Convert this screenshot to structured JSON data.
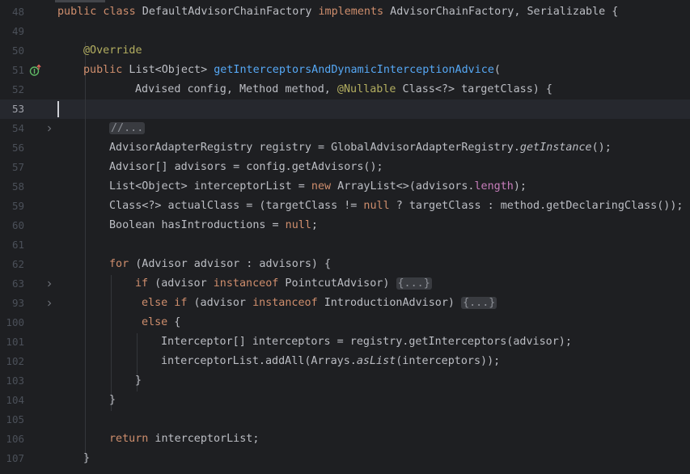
{
  "gutter": {
    "line_numbers": [
      "48",
      "49",
      "50",
      "51",
      "52",
      "53",
      "54",
      "56",
      "57",
      "58",
      "59",
      "60",
      "61",
      "62",
      "63",
      "93",
      "100",
      "101",
      "102",
      "103",
      "104",
      "105",
      "106",
      "107"
    ],
    "current_line": "53",
    "override_icon": "implements-method-icon",
    "fold_icon": "chevron-right-icon"
  },
  "code": {
    "l48_kw1": "public class",
    "l48_name": " DefaultAdvisorChainFactory ",
    "l48_kw2": "implements",
    "l48_rest": " AdvisorChainFactory, Serializable {",
    "l50_ann": "@Override",
    "l51_kw": "public",
    "l51_type": " List<Object> ",
    "l51_fn": "getInterceptorsAndDynamicInterceptionAdvice",
    "l51_rest": "(",
    "l52_a": "Advised config, Method method, ",
    "l52_ann": "@Nullable",
    "l52_b": " Class<?> targetClass) {",
    "l54_fold": "//...",
    "l56_a": "AdvisorAdapterRegistry registry = GlobalAdvisorAdapterRegistry.",
    "l56_it": "getInstance",
    "l56_b": "();",
    "l57": "Advisor[] advisors = config.getAdvisors();",
    "l58_a": "List<Object> interceptorList = ",
    "l58_kw": "new",
    "l58_b": " ArrayList<>(advisors.",
    "l58_fld": "length",
    "l58_c": ");",
    "l59_a": "Class<?> actualClass = (targetClass != ",
    "l59_kw": "null",
    "l59_b": " ? targetClass : method.getDeclaringClass());",
    "l60_a": "Boolean hasIntroductions = ",
    "l60_kw": "null",
    "l60_b": ";",
    "l62_kw": "for",
    "l62_rest": " (Advisor advisor : advisors) {",
    "l63_kw": "if",
    "l63_a": " (advisor ",
    "l63_kw2": "instanceof",
    "l63_b": " PointcutAdvisor) ",
    "l63_fold": "{...}",
    "l93_kw": "else if",
    "l93_a": " (advisor ",
    "l93_kw2": "instanceof",
    "l93_b": " IntroductionAdvisor) ",
    "l93_fold": "{...}",
    "l100_kw": "else",
    "l100_rest": " {",
    "l101": "Interceptor[] interceptors = registry.getInterceptors(advisor);",
    "l102_a": "interceptorList.addAll(Arrays.",
    "l102_it": "asList",
    "l102_b": "(interceptors));",
    "l103": "}",
    "l104": "}",
    "l106_kw": "return",
    "l106_rest": " interceptorList;",
    "l107": "}"
  },
  "colors": {
    "background": "#1e1f22",
    "keyword": "#cf8e6d",
    "annotation": "#b3ae60",
    "method": "#56a8f5",
    "field": "#c77dbb",
    "text": "#bcbec4",
    "line_number": "#4b5059"
  }
}
